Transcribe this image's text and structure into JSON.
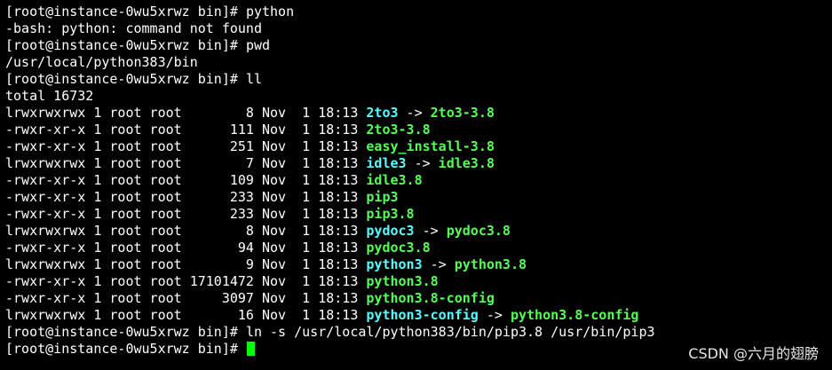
{
  "colors": {
    "background": "#000000",
    "text": "#ffffff",
    "executable": "#55ff55",
    "symlink": "#55ffff",
    "cursor": "#00ff00"
  },
  "lines": [
    {
      "type": "prompt",
      "prompt": "[root@instance-0wu5xrwz bin]# ",
      "command": "python"
    },
    {
      "type": "output",
      "text": "-bash: python: command not found"
    },
    {
      "type": "prompt",
      "prompt": "[root@instance-0wu5xrwz bin]# ",
      "command": "pwd"
    },
    {
      "type": "output",
      "text": "/usr/local/python383/bin"
    },
    {
      "type": "prompt",
      "prompt": "[root@instance-0wu5xrwz bin]# ",
      "command": "ll"
    },
    {
      "type": "output",
      "text": "total 16732"
    },
    {
      "type": "entry",
      "meta": "lrwxrwxrwx 1 root root        8 Nov  1 18:13 ",
      "name": "2to3",
      "kind": "link",
      "target": "2to3-3.8"
    },
    {
      "type": "entry",
      "meta": "-rwxr-xr-x 1 root root      111 Nov  1 18:13 ",
      "name": "2to3-3.8",
      "kind": "exec"
    },
    {
      "type": "entry",
      "meta": "-rwxr-xr-x 1 root root      251 Nov  1 18:13 ",
      "name": "easy_install-3.8",
      "kind": "exec"
    },
    {
      "type": "entry",
      "meta": "lrwxrwxrwx 1 root root        7 Nov  1 18:13 ",
      "name": "idle3",
      "kind": "link",
      "target": "idle3.8"
    },
    {
      "type": "entry",
      "meta": "-rwxr-xr-x 1 root root      109 Nov  1 18:13 ",
      "name": "idle3.8",
      "kind": "exec"
    },
    {
      "type": "entry",
      "meta": "-rwxr-xr-x 1 root root      233 Nov  1 18:13 ",
      "name": "pip3",
      "kind": "exec"
    },
    {
      "type": "entry",
      "meta": "-rwxr-xr-x 1 root root      233 Nov  1 18:13 ",
      "name": "pip3.8",
      "kind": "exec"
    },
    {
      "type": "entry",
      "meta": "lrwxrwxrwx 1 root root        8 Nov  1 18:13 ",
      "name": "pydoc3",
      "kind": "link",
      "target": "pydoc3.8"
    },
    {
      "type": "entry",
      "meta": "-rwxr-xr-x 1 root root       94 Nov  1 18:13 ",
      "name": "pydoc3.8",
      "kind": "exec"
    },
    {
      "type": "entry",
      "meta": "lrwxrwxrwx 1 root root        9 Nov  1 18:13 ",
      "name": "python3",
      "kind": "link",
      "target": "python3.8"
    },
    {
      "type": "entry",
      "meta": "-rwxr-xr-x 1 root root 17101472 Nov  1 18:13 ",
      "name": "python3.8",
      "kind": "exec"
    },
    {
      "type": "entry",
      "meta": "-rwxr-xr-x 1 root root     3097 Nov  1 18:13 ",
      "name": "python3.8-config",
      "kind": "exec"
    },
    {
      "type": "entry",
      "meta": "lrwxrwxrwx 1 root root       16 Nov  1 18:13 ",
      "name": "python3-config",
      "kind": "link",
      "target": "python3.8-config"
    },
    {
      "type": "prompt",
      "prompt": "[root@instance-0wu5xrwz bin]# ",
      "command": "ln -s /usr/local/python383/bin/pip3.8 /usr/bin/pip3"
    },
    {
      "type": "prompt",
      "prompt": "[root@instance-0wu5xrwz bin]# ",
      "command": "",
      "cursor": true
    }
  ],
  "link_arrow": " -> ",
  "watermark": "CSDN @六月的翅膀"
}
